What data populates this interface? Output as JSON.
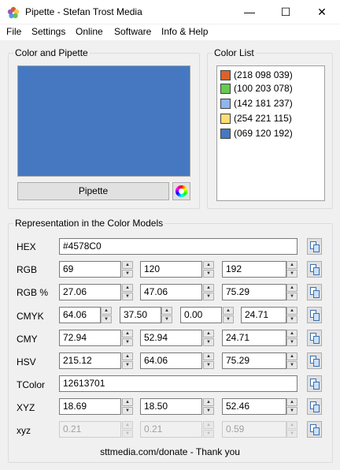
{
  "window": {
    "title": "Pipette - Stefan Trost Media",
    "minimize_glyph": "—",
    "maximize_glyph": "☐",
    "close_glyph": "✕"
  },
  "menu": [
    "File",
    "Settings",
    "Online",
    "Software",
    "Info & Help"
  ],
  "color_pipette": {
    "group_title": "Color and Pipette",
    "current_color": "#4578C0",
    "pipette_label": "Pipette"
  },
  "color_list": {
    "group_title": "Color List",
    "items": [
      {
        "label": "(218 098 039)",
        "color": "#DA6227"
      },
      {
        "label": "(100 203 078)",
        "color": "#64CB4E"
      },
      {
        "label": "(142 181 237)",
        "color": "#8EB5ED"
      },
      {
        "label": "(254 221 115)",
        "color": "#FEDD73"
      },
      {
        "label": "(069 120 192)",
        "color": "#4578C0"
      }
    ]
  },
  "models": {
    "group_title": "Representation in the Color Models",
    "hex": {
      "label": "HEX",
      "value": "#4578C0"
    },
    "rgb": {
      "label": "RGB",
      "values": [
        "69",
        "120",
        "192"
      ]
    },
    "rgb_pct": {
      "label": "RGB %",
      "values": [
        "27.06",
        "47.06",
        "75.29"
      ]
    },
    "cmyk": {
      "label": "CMYK",
      "values": [
        "64.06",
        "37.50",
        "0.00",
        "24.71"
      ]
    },
    "cmy": {
      "label": "CMY",
      "values": [
        "72.94",
        "52.94",
        "24.71"
      ]
    },
    "hsv": {
      "label": "HSV",
      "values": [
        "215.12",
        "64.06",
        "75.29"
      ]
    },
    "tcolor": {
      "label": "TColor",
      "value": "12613701"
    },
    "xyz": {
      "label": "XYZ",
      "values": [
        "18.69",
        "18.50",
        "52.46"
      ]
    },
    "xyz_small": {
      "label": "xyz",
      "values": [
        "0.21",
        "0.21",
        "0.59"
      ]
    }
  },
  "footer": "sttmedia.com/donate - Thank you"
}
